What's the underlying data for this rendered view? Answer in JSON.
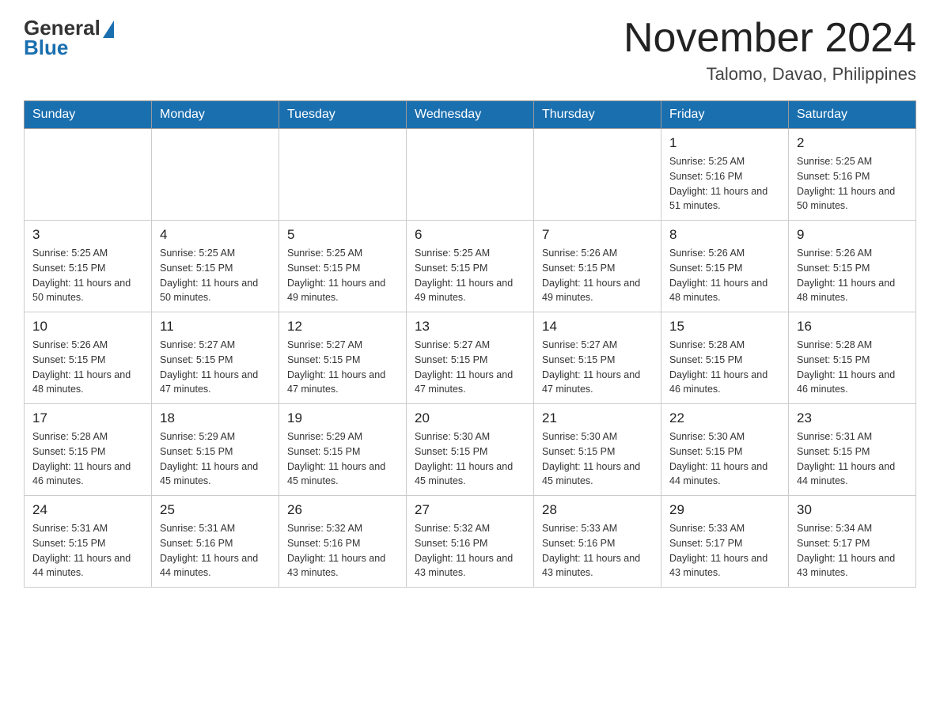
{
  "header": {
    "logo": {
      "general": "General",
      "blue": "Blue"
    },
    "month_title": "November 2024",
    "location": "Talomo, Davao, Philippines"
  },
  "weekdays": [
    "Sunday",
    "Monday",
    "Tuesday",
    "Wednesday",
    "Thursday",
    "Friday",
    "Saturday"
  ],
  "weeks": [
    [
      {
        "day": "",
        "info": ""
      },
      {
        "day": "",
        "info": ""
      },
      {
        "day": "",
        "info": ""
      },
      {
        "day": "",
        "info": ""
      },
      {
        "day": "",
        "info": ""
      },
      {
        "day": "1",
        "info": "Sunrise: 5:25 AM\nSunset: 5:16 PM\nDaylight: 11 hours and 51 minutes."
      },
      {
        "day": "2",
        "info": "Sunrise: 5:25 AM\nSunset: 5:16 PM\nDaylight: 11 hours and 50 minutes."
      }
    ],
    [
      {
        "day": "3",
        "info": "Sunrise: 5:25 AM\nSunset: 5:15 PM\nDaylight: 11 hours and 50 minutes."
      },
      {
        "day": "4",
        "info": "Sunrise: 5:25 AM\nSunset: 5:15 PM\nDaylight: 11 hours and 50 minutes."
      },
      {
        "day": "5",
        "info": "Sunrise: 5:25 AM\nSunset: 5:15 PM\nDaylight: 11 hours and 49 minutes."
      },
      {
        "day": "6",
        "info": "Sunrise: 5:25 AM\nSunset: 5:15 PM\nDaylight: 11 hours and 49 minutes."
      },
      {
        "day": "7",
        "info": "Sunrise: 5:26 AM\nSunset: 5:15 PM\nDaylight: 11 hours and 49 minutes."
      },
      {
        "day": "8",
        "info": "Sunrise: 5:26 AM\nSunset: 5:15 PM\nDaylight: 11 hours and 48 minutes."
      },
      {
        "day": "9",
        "info": "Sunrise: 5:26 AM\nSunset: 5:15 PM\nDaylight: 11 hours and 48 minutes."
      }
    ],
    [
      {
        "day": "10",
        "info": "Sunrise: 5:26 AM\nSunset: 5:15 PM\nDaylight: 11 hours and 48 minutes."
      },
      {
        "day": "11",
        "info": "Sunrise: 5:27 AM\nSunset: 5:15 PM\nDaylight: 11 hours and 47 minutes."
      },
      {
        "day": "12",
        "info": "Sunrise: 5:27 AM\nSunset: 5:15 PM\nDaylight: 11 hours and 47 minutes."
      },
      {
        "day": "13",
        "info": "Sunrise: 5:27 AM\nSunset: 5:15 PM\nDaylight: 11 hours and 47 minutes."
      },
      {
        "day": "14",
        "info": "Sunrise: 5:27 AM\nSunset: 5:15 PM\nDaylight: 11 hours and 47 minutes."
      },
      {
        "day": "15",
        "info": "Sunrise: 5:28 AM\nSunset: 5:15 PM\nDaylight: 11 hours and 46 minutes."
      },
      {
        "day": "16",
        "info": "Sunrise: 5:28 AM\nSunset: 5:15 PM\nDaylight: 11 hours and 46 minutes."
      }
    ],
    [
      {
        "day": "17",
        "info": "Sunrise: 5:28 AM\nSunset: 5:15 PM\nDaylight: 11 hours and 46 minutes."
      },
      {
        "day": "18",
        "info": "Sunrise: 5:29 AM\nSunset: 5:15 PM\nDaylight: 11 hours and 45 minutes."
      },
      {
        "day": "19",
        "info": "Sunrise: 5:29 AM\nSunset: 5:15 PM\nDaylight: 11 hours and 45 minutes."
      },
      {
        "day": "20",
        "info": "Sunrise: 5:30 AM\nSunset: 5:15 PM\nDaylight: 11 hours and 45 minutes."
      },
      {
        "day": "21",
        "info": "Sunrise: 5:30 AM\nSunset: 5:15 PM\nDaylight: 11 hours and 45 minutes."
      },
      {
        "day": "22",
        "info": "Sunrise: 5:30 AM\nSunset: 5:15 PM\nDaylight: 11 hours and 44 minutes."
      },
      {
        "day": "23",
        "info": "Sunrise: 5:31 AM\nSunset: 5:15 PM\nDaylight: 11 hours and 44 minutes."
      }
    ],
    [
      {
        "day": "24",
        "info": "Sunrise: 5:31 AM\nSunset: 5:15 PM\nDaylight: 11 hours and 44 minutes."
      },
      {
        "day": "25",
        "info": "Sunrise: 5:31 AM\nSunset: 5:16 PM\nDaylight: 11 hours and 44 minutes."
      },
      {
        "day": "26",
        "info": "Sunrise: 5:32 AM\nSunset: 5:16 PM\nDaylight: 11 hours and 43 minutes."
      },
      {
        "day": "27",
        "info": "Sunrise: 5:32 AM\nSunset: 5:16 PM\nDaylight: 11 hours and 43 minutes."
      },
      {
        "day": "28",
        "info": "Sunrise: 5:33 AM\nSunset: 5:16 PM\nDaylight: 11 hours and 43 minutes."
      },
      {
        "day": "29",
        "info": "Sunrise: 5:33 AM\nSunset: 5:17 PM\nDaylight: 11 hours and 43 minutes."
      },
      {
        "day": "30",
        "info": "Sunrise: 5:34 AM\nSunset: 5:17 PM\nDaylight: 11 hours and 43 minutes."
      }
    ]
  ]
}
